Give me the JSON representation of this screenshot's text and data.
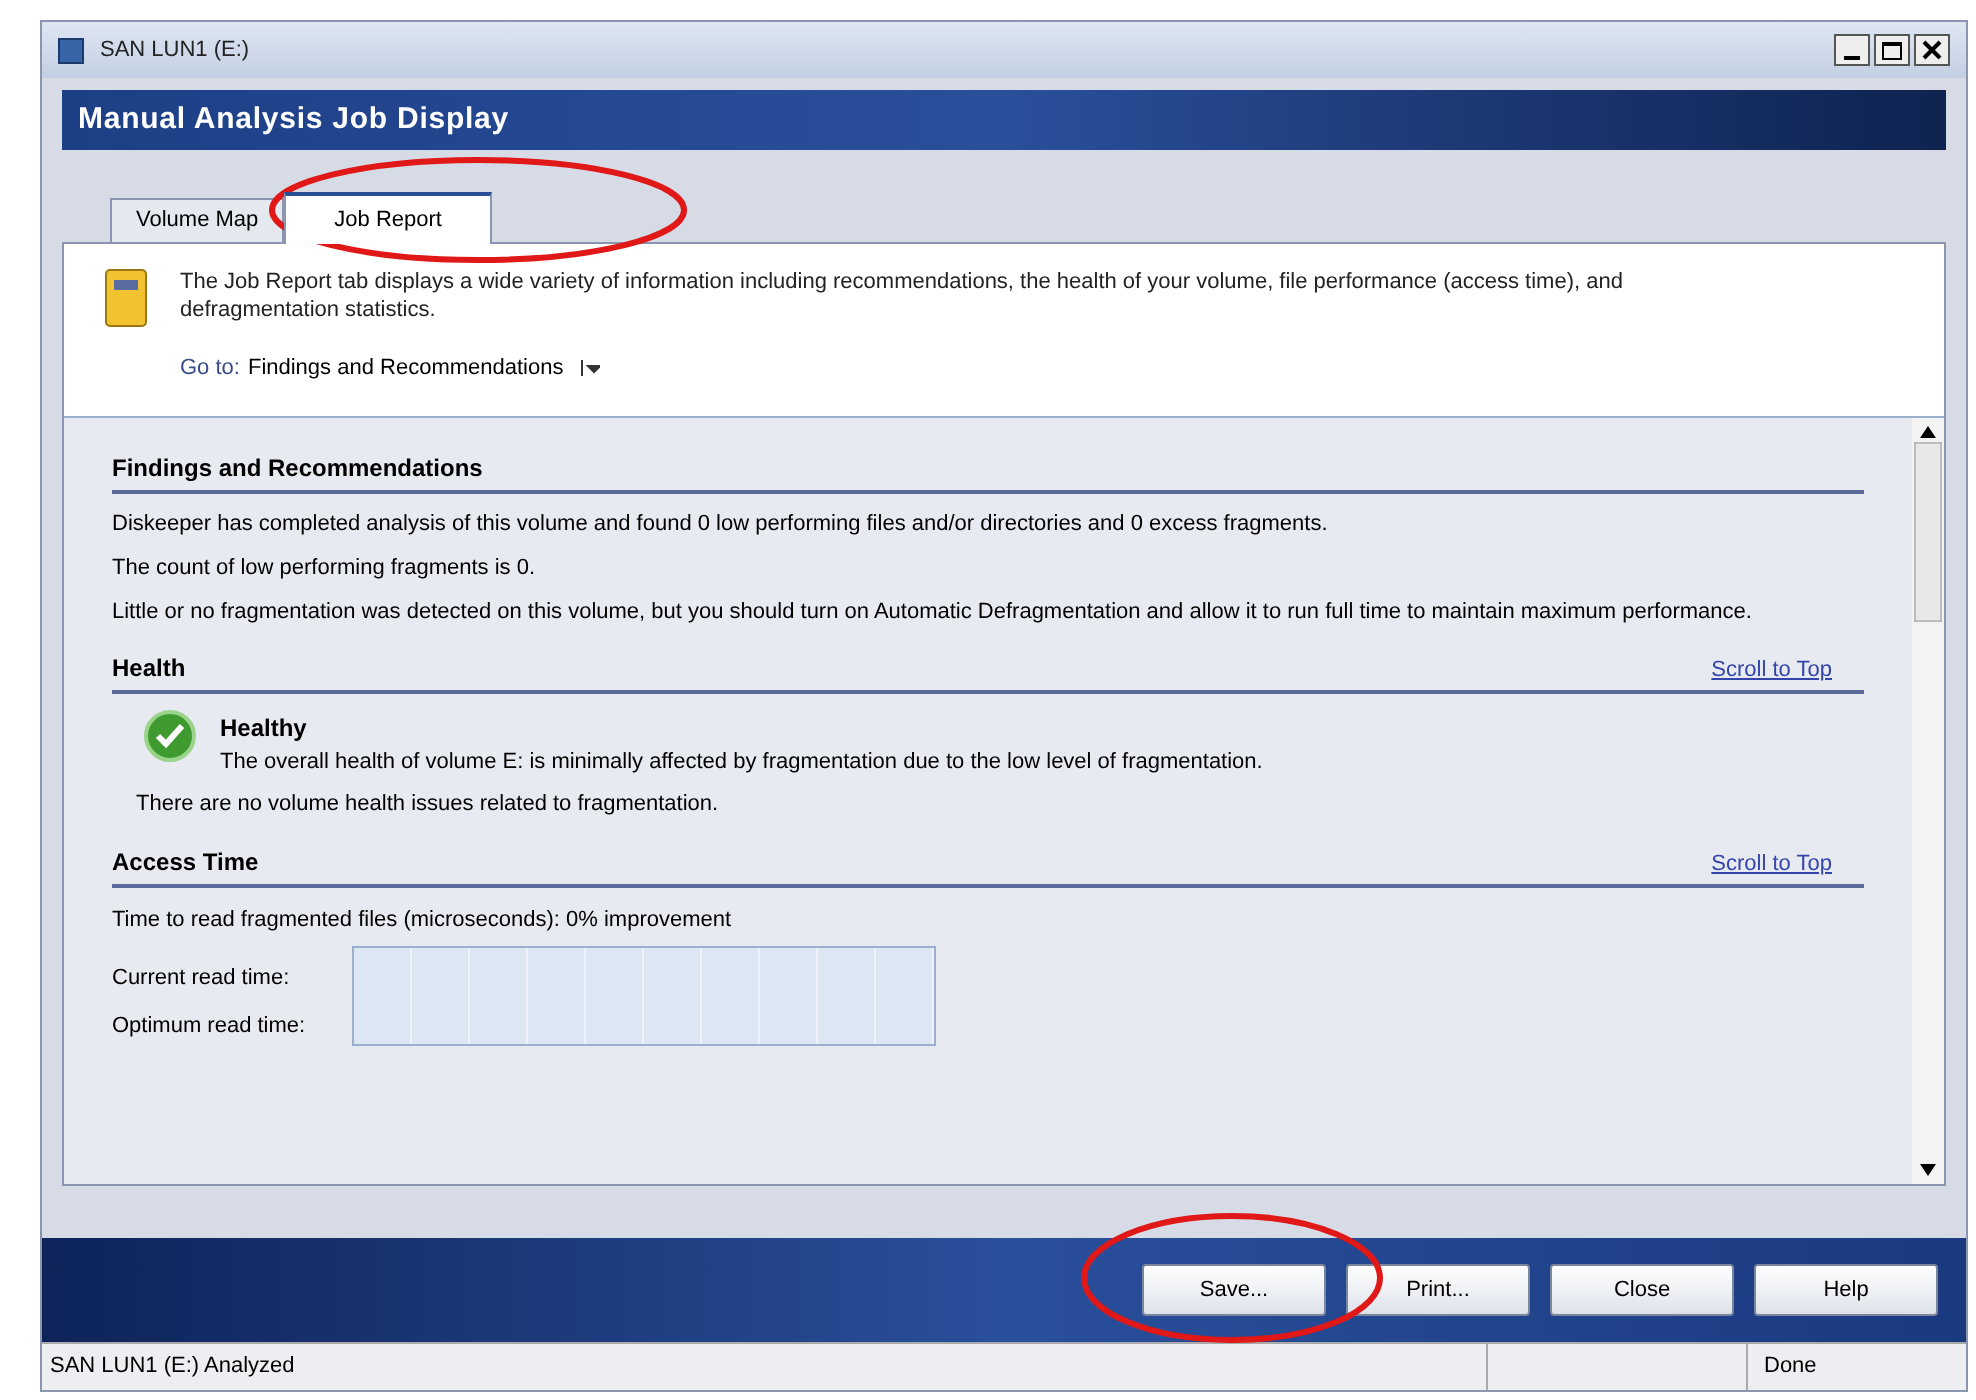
{
  "window": {
    "title": "SAN LUN1 (E:)"
  },
  "header": {
    "title": "Manual Analysis Job Display"
  },
  "tabs": [
    {
      "label": "Volume Map",
      "selected": false
    },
    {
      "label": "Job Report",
      "selected": true
    }
  ],
  "info": {
    "text": "The Job Report tab displays a wide variety of information including recommendations, the health of your volume, file performance (access time), and defragmentation statistics.",
    "goto_label": "Go to:",
    "goto_value": "Findings and Recommendations"
  },
  "sections": [
    {
      "kind": "findings",
      "title": "Findings and Recommendations",
      "paragraphs": [
        "Diskeeper has completed analysis of this volume and found 0 low performing files and/or directories and 0 excess fragments.",
        "The count of low performing fragments is 0.",
        "Little or no fragmentation was detected on this volume, but you should turn on Automatic Defragmentation and allow it to run full time to maintain maximum performance."
      ]
    },
    {
      "kind": "health",
      "title": "Health",
      "link": "Scroll to Top",
      "status": "Healthy",
      "status_text": "The overall health of volume E: is minimally affected by fragmentation due to the low level of fragmentation.",
      "note": "There are no volume health issues related to fragmentation."
    },
    {
      "kind": "access",
      "title": "Access Time",
      "link": "Scroll to Top",
      "summary": "Time to read fragmented files (microseconds): 0% improvement",
      "rows": [
        "Current read time:",
        "Optimum read time:"
      ]
    }
  ],
  "buttons": [
    "Save...",
    "Print...",
    "Close",
    "Help"
  ],
  "status_bar": {
    "message": "SAN LUN1 (E:) Analyzed",
    "state": "Done"
  }
}
